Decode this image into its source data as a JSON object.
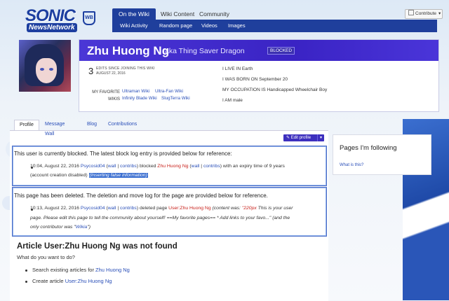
{
  "colors": {
    "brand": "#1f3f9c",
    "masthead": "#4a37d6",
    "link": "#2a4fb8",
    "redlink": "#c8201a",
    "box_border": "#4e6fc8"
  },
  "header": {
    "logo_line1": "SONIC",
    "logo_line2": "NewsNetwork",
    "wb_logo": "WB",
    "tabs": [
      "On the Wiki",
      "Wiki Content",
      "Community"
    ],
    "subnav": [
      "Wiki Activity",
      "Random page",
      "Videos",
      "Images"
    ],
    "contribute_label": "Contribute",
    "contribute_icon": "pencil-icon"
  },
  "profile": {
    "username": "Zhu Huong Ng",
    "aka": "aka Thing Saver Dragon",
    "blocked_badge": "BLOCKED",
    "edits_count": "3",
    "edits_label": "EDITS SINCE JOINING THIS WIKI",
    "edits_date": "AUGUST 22, 2016",
    "favorite_label_1": "MY FAVORITE",
    "favorite_label_2": "WIKIS",
    "favorite_wikis": [
      "Ultraman Wiki",
      "Ultra-Fan Wiki",
      "Infinity Blade Wiki",
      "SlugTerra Wiki"
    ],
    "facts": [
      {
        "label": "I LIVE IN",
        "value": "Earth"
      },
      {
        "label": "I WAS BORN ON",
        "value": "September 20"
      },
      {
        "label": "MY OCCUPATION IS",
        "value": "Handicapped Wheelchair Boy"
      },
      {
        "label": "I AM",
        "value": "male"
      }
    ]
  },
  "page_tabs": [
    "Profile",
    "Message Wall",
    "Blog",
    "Contributions"
  ],
  "edit_button": "Edit profile",
  "block_notice": {
    "text": "This user is currently blocked. The latest block log entry is provided below for reference:",
    "time": "10:04, August 22, 2016",
    "actor": "Psycosid04",
    "wall": "wall",
    "contribs": "contribs",
    "action": "blocked",
    "target": "Zhu Huong Ng",
    "expiry": "with an expiry time of 9 years",
    "detail": "(account creation disabled)",
    "reason": "(Inserting false information)"
  },
  "delete_notice": {
    "text": "This page has been deleted. The deletion and move log for the page are provided below for reference.",
    "time": "10:13, August 22, 2016",
    "actor": "Psycosid04",
    "wall": "wall",
    "contribs": "contribs",
    "action": "deleted page",
    "target": "User:Zhu Huong Ng",
    "content_prefix": "(content was: ",
    "content_quote": "\"220px",
    "content_rest": " This is your user",
    "line2": "page. Please edit this page to tell the community about yourself! ==My favorite pages== * Add links to your favo...\" (and the",
    "line3_prefix": "only contributor was \"",
    "line3_link": "Wikia",
    "line3_suffix": "\")"
  },
  "not_found": {
    "title": "Article User:Zhu Huong Ng was not found",
    "question": "What do you want to do?",
    "search_prefix": "Search existing articles for",
    "search_link": "Zhu Huong Ng",
    "create_prefix": "Create article",
    "create_link": "User:Zhu Huong Ng"
  },
  "rail": {
    "title": "Pages I'm following",
    "link": "What is this?"
  }
}
